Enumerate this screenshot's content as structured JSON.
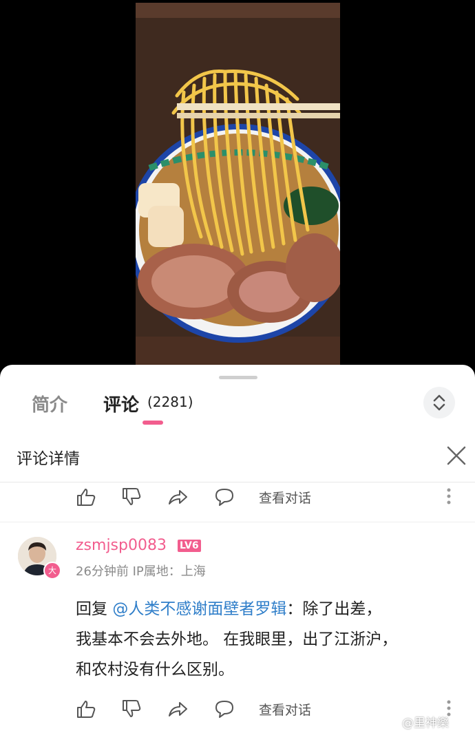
{
  "tabs": {
    "intro": "简介",
    "comments": "评论",
    "comment_count": "(2281)"
  },
  "detail": {
    "title": "评论详情"
  },
  "actions": {
    "view_conversation": "查看对话"
  },
  "comment": {
    "username": "zsmjsp0083",
    "level": "LV6",
    "vip_badge": "大",
    "meta": "26分钟前 IP属地：上海",
    "reply_prefix": "回复 ",
    "mention": "@人类不感谢面壁者罗辑",
    "text_after_mention": "：除了出差，",
    "line2": "我基本不会去外地。 在我眼里，出了江浙沪，",
    "line3": "和农村没有什么区别。"
  },
  "watermark": "@里神樂",
  "colors": {
    "accent": "#f25d8e",
    "mention": "#2f7ec9"
  }
}
